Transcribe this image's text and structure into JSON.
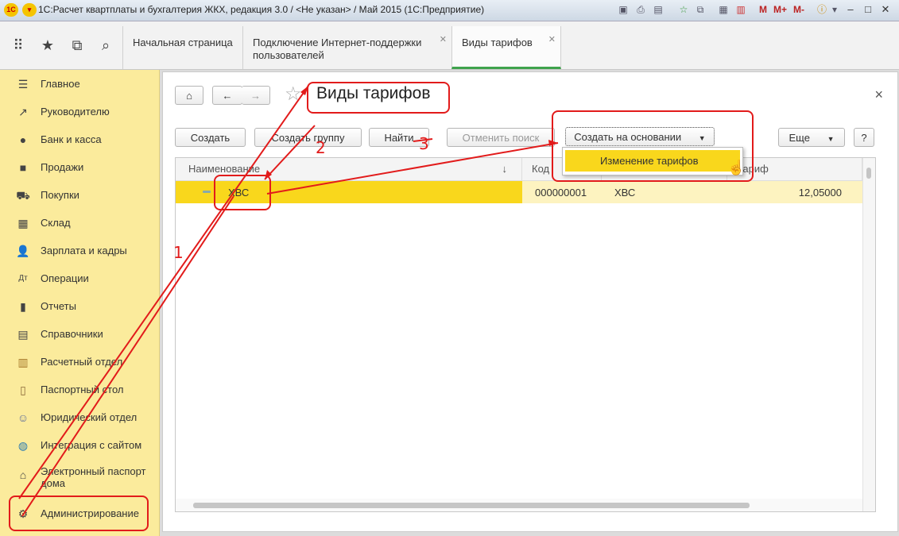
{
  "window": {
    "title": "1С:Расчет квартплаты и бухгалтерия ЖКХ, редакция 3.0 / <Не указан> / Май 2015  (1С:Предприятие)",
    "logo_text": "1С",
    "mem_labels": [
      "M",
      "M+",
      "M-"
    ]
  },
  "tabs": [
    {
      "label": "Начальная страница",
      "closable": false
    },
    {
      "label": "Подключение Интернет-поддержки пользователей",
      "closable": true
    },
    {
      "label": "Виды тарифов",
      "closable": true
    }
  ],
  "sidebar": {
    "items": [
      {
        "label": "Главное",
        "icon": "menu-lines-icon"
      },
      {
        "label": "Руководителю",
        "icon": "trend-icon"
      },
      {
        "label": "Банк и касса",
        "icon": "ruble-coin-icon"
      },
      {
        "label": "Продажи",
        "icon": "shopping-bag-icon"
      },
      {
        "label": "Покупки",
        "icon": "cart-icon"
      },
      {
        "label": "Склад",
        "icon": "warehouse-grid-icon"
      },
      {
        "label": "Зарплата и кадры",
        "icon": "person-icon"
      },
      {
        "label": "Операции",
        "icon": "debit-credit-icon"
      },
      {
        "label": "Отчеты",
        "icon": "bar-chart-icon"
      },
      {
        "label": "Справочники",
        "icon": "book-icon"
      },
      {
        "label": "Расчетный отдел",
        "icon": "calculator-icon"
      },
      {
        "label": "Паспортный стол",
        "icon": "passport-icon"
      },
      {
        "label": "Юридический отдел",
        "icon": "lawyer-icon"
      },
      {
        "label": "Интеграция с сайтом",
        "icon": "globe-icon"
      },
      {
        "label": "Электронный паспорт дома",
        "icon": "house-doc-icon"
      },
      {
        "label": "Администрирование",
        "icon": "gear-icon"
      }
    ]
  },
  "form": {
    "title": "Виды тарифов",
    "close_glyph": "×",
    "buttons": {
      "create": "Создать",
      "create_group": "Создать группу",
      "find": "Найти",
      "cancel_search": "Отменить поиск",
      "create_based_on": "Создать на основании",
      "more": "Еще",
      "help": "?"
    },
    "dropdown_item": "Изменение тарифов",
    "table": {
      "columns": [
        "Наименование",
        "Код",
        "",
        "Тариф"
      ],
      "sort_glyph": "↓",
      "rows": [
        {
          "name": "ХВС",
          "code": "000000001",
          "service": "ХВС",
          "tariff": "12,05000"
        }
      ]
    }
  },
  "annotations": {
    "numbers": [
      "1",
      "2",
      "3"
    ],
    "color": "#e21b1b"
  },
  "colors": {
    "sidebar_bg": "#fbeb9c",
    "selected_row": "#f9d71c",
    "dropdown_item_bg": "#f9d71c",
    "active_tab_line": "#3fa34d"
  }
}
